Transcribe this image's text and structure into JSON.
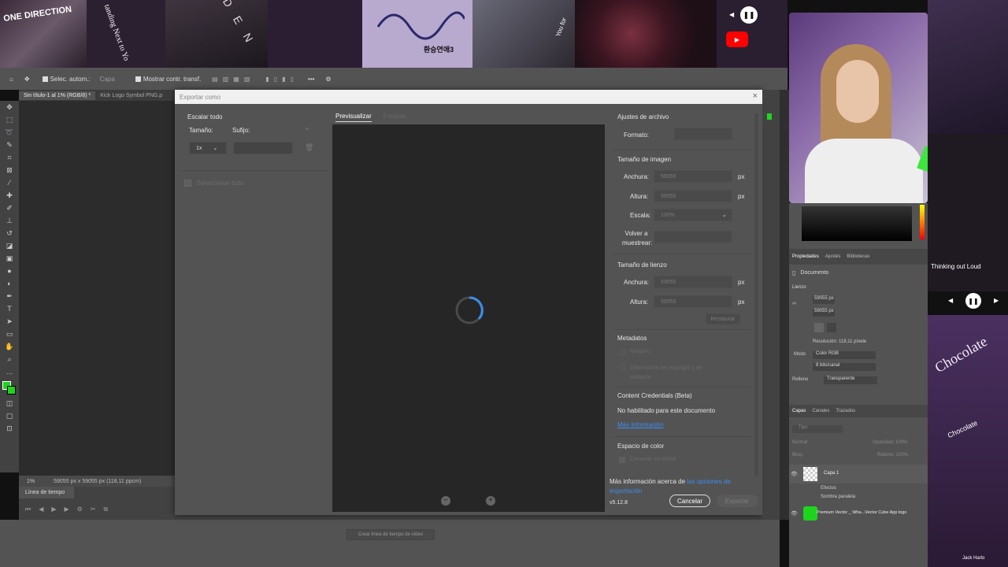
{
  "collage": {
    "one_direction": "ONE DIRECTION",
    "standing": "tanding Next to Yo",
    "den": "D E N",
    "korean": "환승연애3",
    "you_for": "You for"
  },
  "media_top": {
    "play_pause": "pause"
  },
  "media_right": {
    "song": "Thinking out Loud",
    "artist": "Jack Harlo",
    "chocolate1": "Chocolate",
    "chocolate2": "Chocolate"
  },
  "options_bar": {
    "auto_select": "Selec. autom.:",
    "layer": "Capa",
    "show_transform": "Mostrar contr. transf."
  },
  "tabs": {
    "doc1": "Sin título-1 al 1% (RGB/8) *",
    "doc2": "Kick Logo Symbol PNG.p"
  },
  "status": {
    "zoom": "1%",
    "size": "59055 px x 59055 px (118,11 ppcm)"
  },
  "timeline": {
    "title": "Línea de tiempo",
    "create_button": "Crear línea de tiempo de vídeo"
  },
  "dialog": {
    "title": "Exportar como",
    "scale_all": "Escalar todo",
    "size_label": "Tamaño:",
    "suffix_label": "Sufijo:",
    "scale_value": "1x",
    "select_all": "Seleccionar todo",
    "tab_preview": "Previsualizar",
    "tab_copies": "2 copias",
    "file_settings": "Ajustes de archivo",
    "format_label": "Formato:",
    "image_size": "Tamaño de imagen",
    "width_label": "Anchura:",
    "height_label": "Altura:",
    "scale_label": "Escala:",
    "resample_label": "Volver a muestrear:",
    "width_value": "59055",
    "height_value": "59055",
    "scale_value2": "100%",
    "px": "px",
    "canvas_size": "Tamaño de lienzo",
    "canvas_width": "59055",
    "canvas_height": "59055",
    "restore": "Restaurar",
    "metadata": "Metadatos",
    "meta_none": "Ninguno",
    "meta_copyright": "Información de copyright y de contacto",
    "content_credentials": "Content Credentials (Beta)",
    "not_enabled": "No habilitado para este documento",
    "more_info": "Más información",
    "color_space": "Espacio de color",
    "convert_srgb": "Convertir en sRGB",
    "export_info_prefix": "Más información acerca de ",
    "export_info_link": "las opciones de exportación",
    "version": "v5.12.8",
    "cancel": "Cancelar",
    "export": "Exportar"
  },
  "properties": {
    "tabs": [
      "Propiedades",
      "Ajustes",
      "Bibliotecas"
    ],
    "document": "Documento",
    "canvas": "Lienzo",
    "w": "59055 px",
    "h": "59055 px",
    "resolution": "Resolución: 118,11 píxele",
    "mode_label": "Modo",
    "mode": "Color RGB",
    "bits": "8 bits/canal",
    "fill_label": "Relleno",
    "fill": "Transparente"
  },
  "layers": {
    "tabs": [
      "Capas",
      "Canales",
      "Trazados"
    ],
    "search": "Tipo",
    "blend": "Normal",
    "opacity": "Opacidad: 100%",
    "lock": "Bloq.:",
    "fill": "Relleno: 100%",
    "layer1": "Capa 1",
    "effects": "Efectos",
    "shadow": "Sombra paralela",
    "layer2": "Premium Vector _ Wha...Vector Cube App logo"
  },
  "colors": {
    "accent": "#3b8ded",
    "green": "#1ed51e",
    "youtube": "#ff0000"
  }
}
